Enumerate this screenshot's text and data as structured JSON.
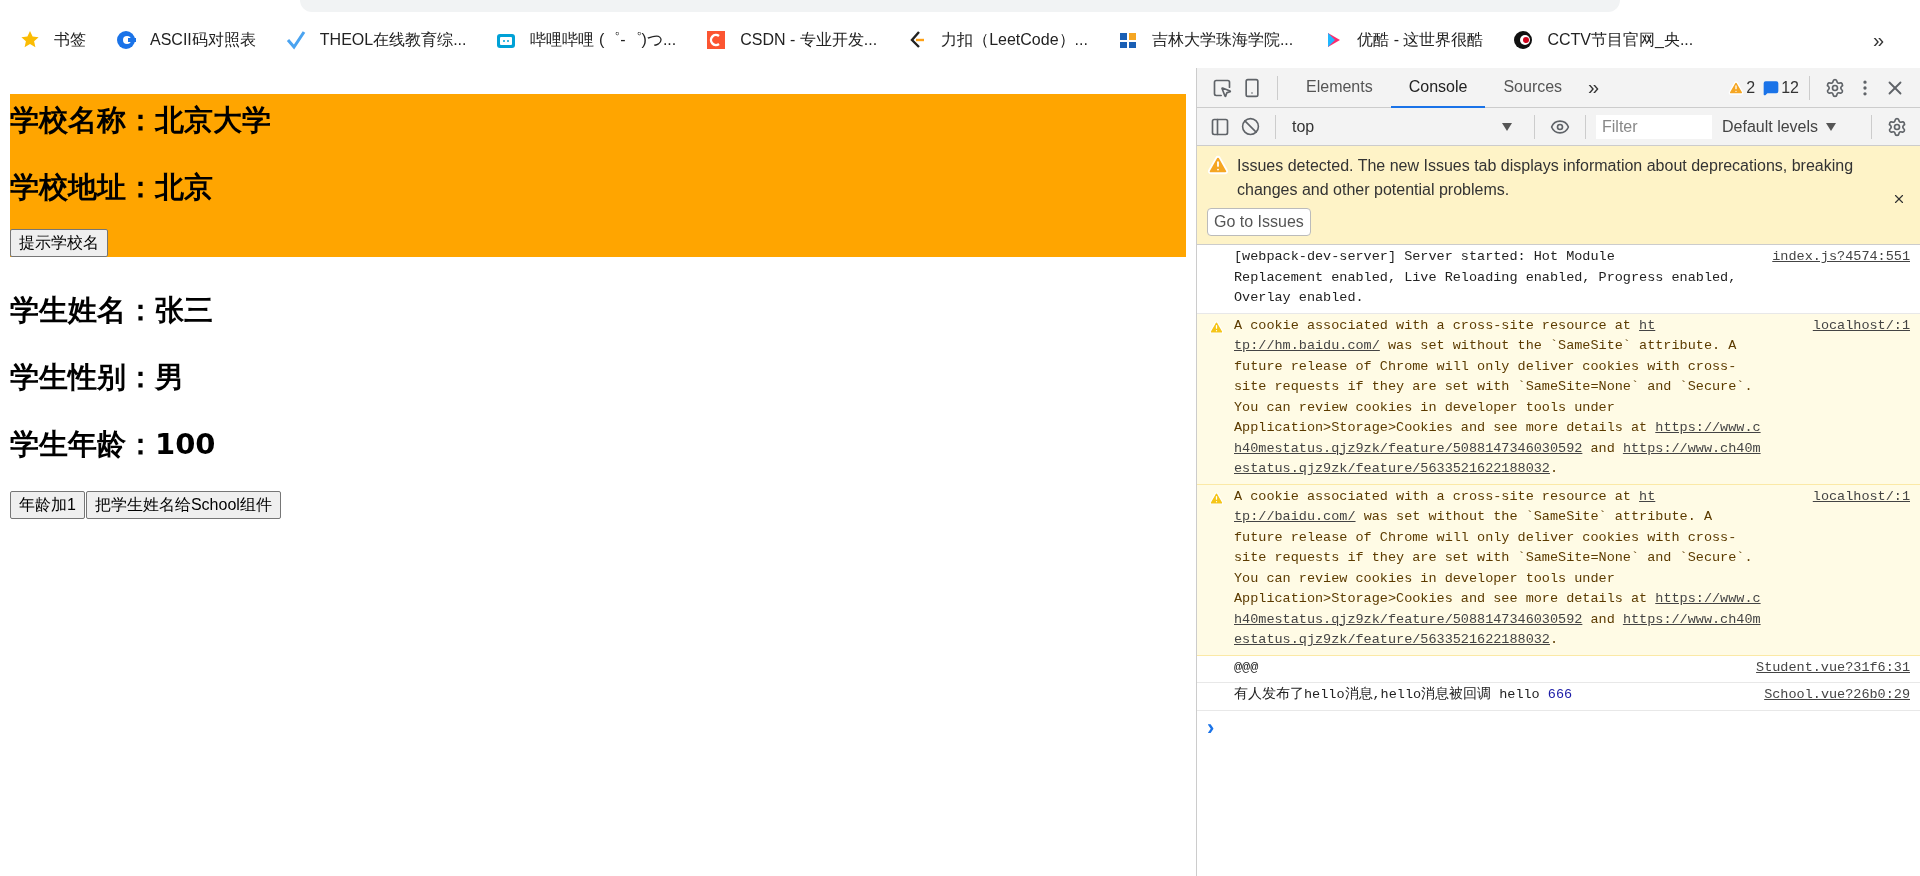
{
  "bookmarks": {
    "items": [
      {
        "label": "书签"
      },
      {
        "label": "ASCII码对照表"
      },
      {
        "label": "THEOL在线教育综..."
      },
      {
        "label": "哔哩哔哩 (゜-゜)つ..."
      },
      {
        "label": "CSDN - 专业开发..."
      },
      {
        "label": "力扣（LeetCode）..."
      },
      {
        "label": "吉林大学珠海学院..."
      },
      {
        "label": "优酷 - 这世界很酷"
      },
      {
        "label": "CCTV节目官网_央..."
      }
    ],
    "more": "»"
  },
  "page": {
    "school": {
      "headings": [
        "学校名称：北京大学",
        "学校地址：北京"
      ],
      "button": "提示学校名"
    },
    "student": {
      "headings": [
        "学生姓名：张三",
        "学生性别：男",
        "学生年龄：100"
      ],
      "buttons": [
        "年龄加1",
        "把学生姓名给School组件"
      ]
    }
  },
  "devtools": {
    "tabs": [
      {
        "label": "Elements",
        "selected": false
      },
      {
        "label": "Console",
        "selected": true
      },
      {
        "label": "Sources",
        "selected": false
      }
    ],
    "more_tabs": "»",
    "warning_count": "2",
    "message_count": "12",
    "context": "top",
    "filter": {
      "placeholder": "Filter"
    },
    "levels": "Default levels",
    "banner": {
      "text": "Issues detected. The new Issues tab displays information about deprecations, breaking changes and other potential problems.",
      "button": "Go to Issues"
    },
    "messages": [
      {
        "kind": "info",
        "source": "index.js?4574:551",
        "lines": [
          [
            {
              "kind": "text",
              "text": "[webpack-dev-server] Server started: Hot Module"
            }
          ],
          [
            {
              "kind": "text",
              "text": "Replacement enabled, Live Reloading enabled, Progress enabled,"
            }
          ],
          [
            {
              "kind": "text",
              "text": "Overlay enabled."
            }
          ]
        ]
      },
      {
        "kind": "warning",
        "source": "localhost/:1",
        "lines": [
          [
            {
              "kind": "text",
              "text": "A cookie associated with a cross-site resource at "
            },
            {
              "kind": "link",
              "text": "ht"
            }
          ],
          [
            {
              "kind": "link",
              "text": "tp://hm.baidu.com/"
            },
            {
              "kind": "text",
              "text": " was set without the `SameSite` attribute. A"
            }
          ],
          [
            {
              "kind": "text",
              "text": "future release of Chrome will only deliver cookies with cross-"
            }
          ],
          [
            {
              "kind": "text",
              "text": "site requests if they are set with `SameSite=None` and `Secure`."
            }
          ],
          [
            {
              "kind": "text",
              "text": "You can review cookies in developer tools under"
            }
          ],
          [
            {
              "kind": "text",
              "text": "Application>Storage>Cookies and see more details at "
            },
            {
              "kind": "link",
              "text": "https://www.c"
            }
          ],
          [
            {
              "kind": "link",
              "text": "h40mestatus.qjz9zk/feature/5088147346030592"
            },
            {
              "kind": "text",
              "text": " and "
            },
            {
              "kind": "link",
              "text": "https://www.ch40m"
            }
          ],
          [
            {
              "kind": "link",
              "text": "estatus.qjz9zk/feature/5633521622188032"
            },
            {
              "kind": "text",
              "text": "."
            }
          ]
        ]
      },
      {
        "kind": "warning",
        "source": "localhost/:1",
        "lines": [
          [
            {
              "kind": "text",
              "text": "A cookie associated with a cross-site resource at "
            },
            {
              "kind": "link",
              "text": "ht"
            }
          ],
          [
            {
              "kind": "link",
              "text": "tp://baidu.com/"
            },
            {
              "kind": "text",
              "text": " was set without the `SameSite` attribute. A"
            }
          ],
          [
            {
              "kind": "text",
              "text": "future release of Chrome will only deliver cookies with cross-"
            }
          ],
          [
            {
              "kind": "text",
              "text": "site requests if they are set with `SameSite=None` and `Secure`."
            }
          ],
          [
            {
              "kind": "text",
              "text": "You can review cookies in developer tools under"
            }
          ],
          [
            {
              "kind": "text",
              "text": "Application>Storage>Cookies and see more details at "
            },
            {
              "kind": "link",
              "text": "https://www.c"
            }
          ],
          [
            {
              "kind": "link",
              "text": "h40mestatus.qjz9zk/feature/5088147346030592"
            },
            {
              "kind": "text",
              "text": " and "
            },
            {
              "kind": "link",
              "text": "https://www.ch40m"
            }
          ],
          [
            {
              "kind": "link",
              "text": "estatus.qjz9zk/feature/5633521622188032"
            },
            {
              "kind": "text",
              "text": "."
            }
          ]
        ]
      },
      {
        "kind": "log",
        "source": "Student.vue?31f6:31",
        "lines": [
          [
            {
              "kind": "text",
              "text": "@@@"
            }
          ]
        ]
      },
      {
        "kind": "log",
        "source": "School.vue?26b0:29",
        "lines": [
          [
            {
              "kind": "text",
              "text": "有人发布了hello消息,hello消息被回调 hello "
            },
            {
              "kind": "number",
              "text": "666"
            }
          ]
        ]
      }
    ],
    "prompt": "›"
  }
}
